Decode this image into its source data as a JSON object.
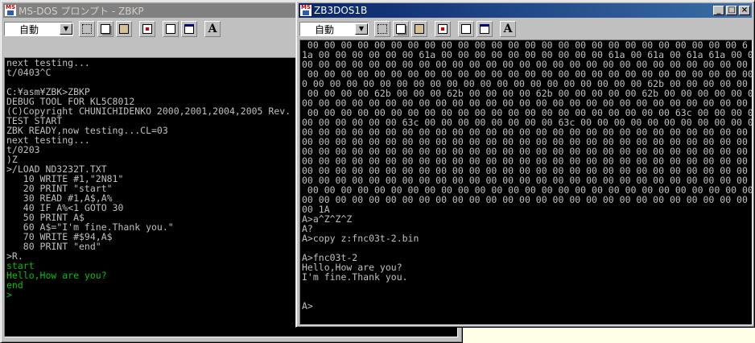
{
  "window1": {
    "title": "MS-DOS プロンプト - ZBKP",
    "font_size_value": "自動",
    "lines": [
      {
        "text": "next testing..."
      },
      {
        "text": "t/0403^C"
      },
      {
        "text": ""
      },
      {
        "text": "C:¥asm¥ZBK>ZBKP"
      },
      {
        "text": "DEBUG TOOL FOR KL5C8012"
      },
      {
        "text": "(C)Copyright CHUNICHIDENKO 2000,2001,2004,2005 Rev."
      },
      {
        "text": "TEST START"
      },
      {
        "text": "ZBK READY,now testing...CL=03"
      },
      {
        "text": "next testing..."
      },
      {
        "text": "t/0203"
      },
      {
        "text": ")Z"
      },
      {
        "text": ">/LOAD ND3232T.TXT"
      },
      {
        "text": "   10 WRITE #1,\"2N81\""
      },
      {
        "text": "   20 PRINT \"start\""
      },
      {
        "text": "   30 READ #1,A$,A%"
      },
      {
        "text": "   40 IF A%<1 GOTO 30"
      },
      {
        "text": "   50 PRINT A$"
      },
      {
        "text": "   60 A$=\"I'm fine.Thank you.\""
      },
      {
        "text": "   70 WRITE #$94,A$"
      },
      {
        "text": "   80 PRINT \"end\""
      },
      {
        "text": ">R."
      },
      {
        "text": "start",
        "color": "green"
      },
      {
        "text": "Hello,How are you?",
        "color": "green"
      },
      {
        "text": "end",
        "color": "green"
      },
      {
        "text": ">",
        "color": "green"
      }
    ]
  },
  "window2": {
    "title": "ZB3DOS1B",
    "font_size_value": "自動",
    "caption_buttons": {
      "minimize": "_",
      "maximize": "□",
      "close": "×"
    },
    "lines": [
      {
        "text": " 00 00 00 00 00 00 00 00 00 00 00 00 00 00 00 00 00 00 00 00 00 00 00 00 00 00 6"
      },
      {
        "text": "1a 00 00 00 00 00 00 61a 00 00 00 00 00 00 00 00 00 00 61a 00 61a 00 61a 61a 00 00"
      },
      {
        "text": "00 00 00 00 00 00 00 00 00 00 00 00 00 00 00 00 00 00 00 00 00 00 00 00 00 00 00 00"
      },
      {
        "text": " 00 00 00 00 00 00 00 00 00 00 00 00 00 00 00 00 00 00 00 00 00 00 00 00 00 00 00"
      },
      {
        "text": "0 00 00 00 00 00 00 00 00 00 00 00 00 00 00 00 00 00 00 00 00 62b 00 00 00 00 00 00"
      },
      {
        "text": " 00 00 00 00 62b 00 00 00 62b 00 00 00 00 62b 00 00 00 00 00 62b 00 00 00 00 00 00"
      },
      {
        "text": "00 00 00 00 00 00 00 00 00 00 00 00 00 00 00 00 00 00 00 00 00 00 00 00 00 00 00 00"
      },
      {
        "text": " 00 00 00 00 00 00 00 00 00 00 00 00 00 00 00 00 00 00 00 00 00 00 63c 00 00 00 00"
      },
      {
        "text": "00 00 00 00 00 00 63c 00 00 00 00 00 00 00 00 63c 00 00 00 00 00 00 00 00 00 00 00"
      },
      {
        "text": "00 00 00 00 00 00 00 00 00 00 00 00 00 00 00 00 00 00 00 00 00 00 00 00 00 00 00 00"
      },
      {
        "text": "00 00 00 00 00 00 00 00 00 00 00 00 00 00 00 00 00 00 00 00 00 00 00 00 00 00 00 00"
      },
      {
        "text": "00 00 00 00 00 00 00 00 00 00 00 00 00 00 00 00 00 00 00 00 00 00 00 00 00 00 00 00"
      },
      {
        "text": "00 00 00 00 00 00 00 00 00 00 00 00 00 00 00 00 00 00 00 00 00 00 00 00 00 00 00 00"
      },
      {
        "text": "00 00 00 00 00 00 00 00 00 00 00 00 00 00 00 00 00 00 00 00 00 00 00 00 00 00 00 00"
      },
      {
        "text": "00 00 00 00 00 00 00 00 00 00 00 00 00 00 00 00 00 00 00 00 00 00 00 00 00 00 00 00"
      },
      {
        "text": " 00 00 00 00 00 00 00 00 00 00 00 00 00 00 00 00 00 00 00 00 00 00 00 00 00 00 00"
      },
      {
        "text": "00 00 00 00 00 00 00 00 00 00 00 00 00 00 00 00 00 00 00 00 00 00 00 00 00 00 00 00"
      },
      {
        "text": "00 1A"
      },
      {
        "text": "A>a^Z^Z^Z"
      },
      {
        "text": "A?"
      },
      {
        "text": "A>copy z:fnc03t-2.bin"
      },
      {
        "text": ""
      },
      {
        "text": "A>fnc03t-2"
      },
      {
        "text": "Hello,How are you?"
      },
      {
        "text": "I'm fine.Thank you."
      },
      {
        "text": ""
      },
      {
        "text": ""
      },
      {
        "text": "A>"
      }
    ]
  }
}
